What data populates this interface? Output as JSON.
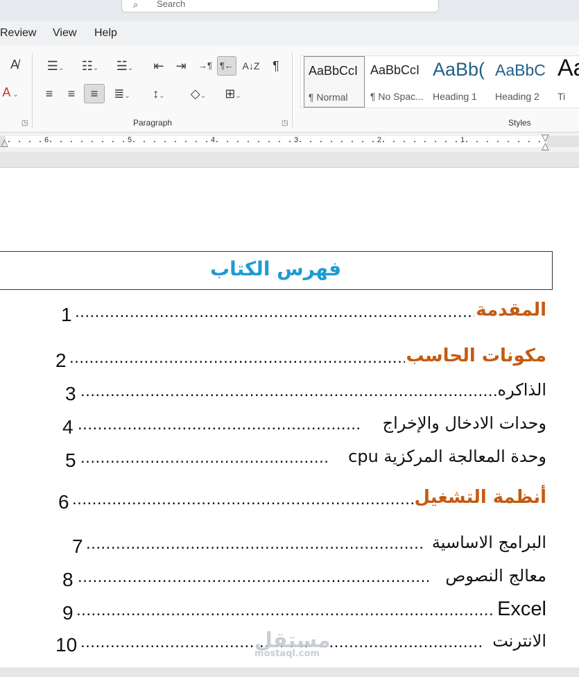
{
  "search": {
    "placeholder": "Search"
  },
  "menu": {
    "review": "Review",
    "view": "View",
    "help": "Help"
  },
  "ribbon": {
    "paragraph_label": "Paragraph",
    "styles_label": "Styles",
    "styles": [
      {
        "sample": "AaBbCcI",
        "name": "¶ Normal"
      },
      {
        "sample": "AaBbCcI",
        "name": "¶ No Spac..."
      },
      {
        "sample": "AaBb(",
        "name": "Heading 1"
      },
      {
        "sample": "AaBbC",
        "name": "Heading 2"
      },
      {
        "sample": "Aa",
        "name": "Ti"
      }
    ]
  },
  "ruler": {
    "numbers": [
      "6",
      "5",
      "4",
      "3",
      "2",
      "1"
    ]
  },
  "document": {
    "title": "فهرس الكتاب",
    "entries": [
      {
        "text": "المقدمة",
        "page": "1",
        "level": "main"
      },
      {
        "text": "مكونات الحاسب",
        "page": "2",
        "level": "main"
      },
      {
        "text": "الذاكره",
        "page": "3",
        "level": "sub"
      },
      {
        "text": "وحدات الادخال والإخراج",
        "page": "4",
        "level": "sub"
      },
      {
        "text": "وحدة المعالجة المركزية cpu",
        "page": "5",
        "level": "sub"
      },
      {
        "text": "أنظمة التشغيل",
        "page": "6",
        "level": "main"
      },
      {
        "text": "البرامج الاساسية",
        "page": "7",
        "level": "sub"
      },
      {
        "text": "معالج النصوص",
        "page": "8",
        "level": "sub"
      },
      {
        "text": "Excel",
        "page": "9",
        "level": "sub"
      },
      {
        "text": "الانترنت",
        "page": "10",
        "level": "sub"
      }
    ]
  },
  "watermark": {
    "arabic": "مستقل",
    "latin": "mostaql.com"
  },
  "colors": {
    "heading": "#c55a11",
    "title": "#1f9bd1"
  }
}
